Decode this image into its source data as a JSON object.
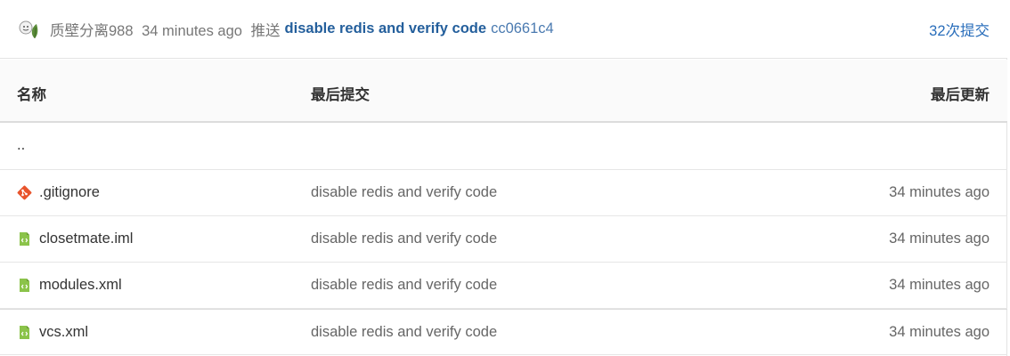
{
  "latest_commit": {
    "author": "质壁分离988",
    "time": "34 minutes ago",
    "action": "推送",
    "message": "disable redis and verify code",
    "hash": "cc0661c4",
    "commit_count": "32次提交"
  },
  "table": {
    "headers": [
      "名称",
      "最后提交",
      "最后更新"
    ],
    "parent": "..",
    "rows": [
      {
        "name": ".gitignore",
        "icon": "git-icon",
        "message": "disable redis and verify code",
        "time": "34 minutes ago"
      },
      {
        "name": "closetmate.iml",
        "icon": "code-file-icon",
        "message": "disable redis and verify code",
        "time": "34 minutes ago"
      },
      {
        "name": "modules.xml",
        "icon": "code-file-icon",
        "message": "disable redis and verify code",
        "time": "34 minutes ago"
      },
      {
        "name": "vcs.xml",
        "icon": "code-file-icon",
        "message": "disable redis and verify code",
        "time": "34 minutes ago"
      }
    ]
  },
  "colors": {
    "git_icon": "#e8542c",
    "file_icon": "#8bc34a",
    "link": "#2a6ebb"
  }
}
